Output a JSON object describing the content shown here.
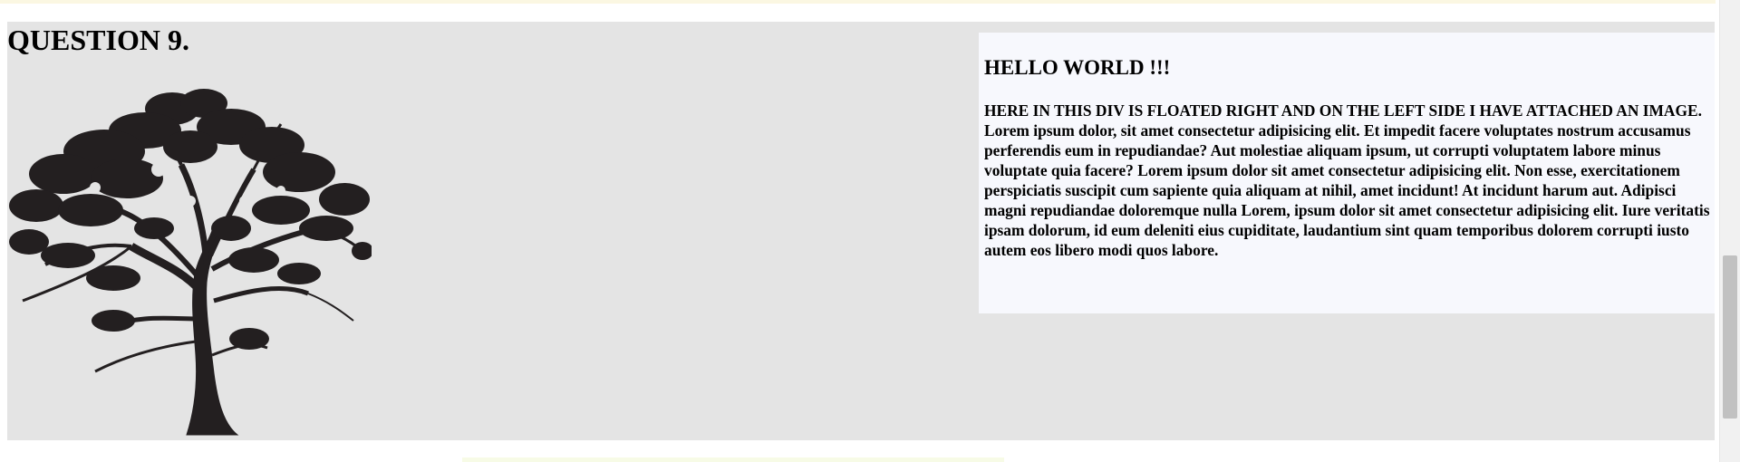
{
  "question": {
    "title": "QUESTION 9.",
    "image_alt": "tree silhouette"
  },
  "right_box": {
    "heading": "HELLO WORLD !!!",
    "paragraph": "HERE IN THIS DIV IS FLOATED RIGHT AND ON THE LEFT SIDE I HAVE ATTACHED AN IMAGE. Lorem ipsum dolor, sit amet consectetur adipisicing elit. Et impedit facere voluptates nostrum accusamus perferendis eum in repudiandae? Aut molestiae aliquam ipsum, ut corrupti voluptatem labore minus voluptate quia facere? Lorem ipsum dolor sit amet consectetur adipisicing elit. Non esse, exercitationem perspiciatis suscipit cum sapiente quia aliquam at nihil, amet incidunt! At incidunt harum aut. Adipisci magni repudiandae doloremque nulla Lorem, ipsum dolor sit amet consectetur adipisicing elit. Iure veritatis ipsam dolorum, id eum deleniti eius cupiditate, laudantium sint quam temporibus dolorem corrupti iusto autem eos libero modi quos labore."
  },
  "colors": {
    "section_bg": "#e4e4e4",
    "box_bg": "#f7f8fd",
    "tree": "#231f20"
  },
  "icons": {
    "tree": "tree-silhouette"
  }
}
